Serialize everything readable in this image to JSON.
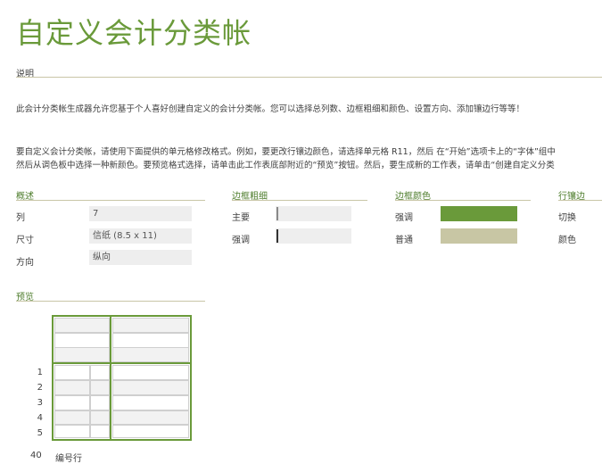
{
  "title": "自定义会计分类帐",
  "sections": {
    "description_label": "说明",
    "description_text": "此会计分类帐生成器允许您基于个人喜好创建自定义的会计分类帐。您可以选择总列数、边框粗细和颜色、设置方向、添加镶边行等等！",
    "instructions_line1": "要自定义会计分类帐，请使用下面提供的单元格修改格式。例如，要更改行镶边颜色，请选择单元格 R11，然后 在“开始”选项卡上的“字体”组中",
    "instructions_line2": "然后从调色板中选择一种新颜色。要预览格式选择，请单击此工作表底部附近的“预览”按钮。然后，要生成新的工作表，请单击“创建自定义分类"
  },
  "overview": {
    "header": "概述",
    "rows": [
      {
        "label": "列",
        "value": "7"
      },
      {
        "label": "尺寸",
        "value": "信纸 (8.5 x 11)"
      },
      {
        "label": "方向",
        "value": "纵向"
      }
    ]
  },
  "border_weight": {
    "header": "边框粗细",
    "rows": [
      {
        "label": "主要"
      },
      {
        "label": "强调"
      }
    ]
  },
  "border_color": {
    "header": "边框颜色",
    "rows": [
      {
        "label": "强调",
        "color": "#6a9a3a"
      },
      {
        "label": "普通",
        "color": "#c8c6a4"
      }
    ]
  },
  "banded_rows": {
    "header": "行镶边",
    "rows": [
      {
        "label": "切换"
      },
      {
        "label": "颜色"
      }
    ]
  },
  "preview": {
    "header": "预览",
    "row_numbers": [
      "1",
      "2",
      "3",
      "4",
      "5"
    ],
    "footer_number": "40",
    "footer_label": "编号行"
  },
  "colors": {
    "accent": "#6a9a3a",
    "rule": "#c9c6a7",
    "field_bg": "#eeeeee"
  }
}
